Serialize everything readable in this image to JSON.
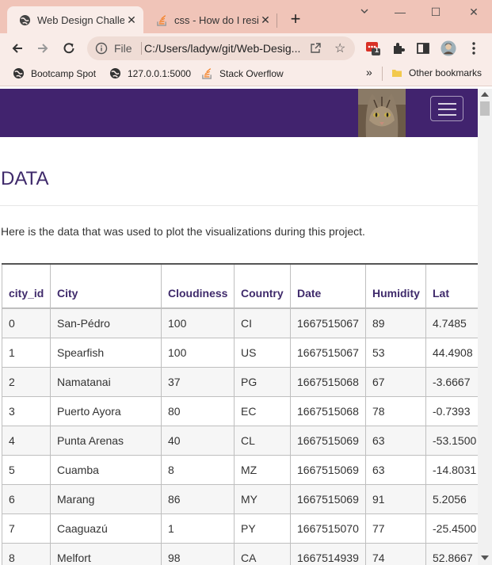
{
  "browser": {
    "tabs": [
      {
        "title": "Web Design Challen",
        "close": "✕"
      },
      {
        "title": "css - How do I resiz",
        "close": "✕"
      }
    ],
    "newtab": "+",
    "window_controls": {
      "minimize": "—",
      "maximize": "☐",
      "close": "✕"
    },
    "omnibox": {
      "scheme_label": "File",
      "url": "C:/Users/ladyw/git/Web-Desig..."
    },
    "extension_badge": "1",
    "bookmarks": [
      {
        "label": "Bootcamp Spot"
      },
      {
        "label": "127.0.0.1:5000"
      },
      {
        "label": "Stack Overflow"
      }
    ],
    "overflow": "»",
    "other_bookmarks": "Other bookmarks"
  },
  "page": {
    "heading": "DATA",
    "intro": "Here is the data that was used to plot the visualizations during this project.",
    "table": {
      "columns": [
        "city_id",
        "City",
        "Cloudiness",
        "Country",
        "Date",
        "Humidity",
        "Lat"
      ],
      "rows": [
        [
          "0",
          "San-Pédro",
          "100",
          "CI",
          "1667515067",
          "89",
          "4.7485"
        ],
        [
          "1",
          "Spearfish",
          "100",
          "US",
          "1667515067",
          "53",
          "44.4908"
        ],
        [
          "2",
          "Namatanai",
          "37",
          "PG",
          "1667515068",
          "67",
          "-3.6667"
        ],
        [
          "3",
          "Puerto Ayora",
          "80",
          "EC",
          "1667515068",
          "78",
          "-0.7393"
        ],
        [
          "4",
          "Punta Arenas",
          "40",
          "CL",
          "1667515069",
          "63",
          "-53.1500"
        ],
        [
          "5",
          "Cuamba",
          "8",
          "MZ",
          "1667515069",
          "63",
          "-14.8031"
        ],
        [
          "6",
          "Marang",
          "86",
          "MY",
          "1667515069",
          "91",
          "5.2056"
        ],
        [
          "7",
          "Caaguazú",
          "1",
          "PY",
          "1667515070",
          "77",
          "-25.4500"
        ],
        [
          "8",
          "Melfort",
          "98",
          "CA",
          "1667514939",
          "74",
          "52.8667"
        ]
      ]
    }
  },
  "colors": {
    "navbar": "#41236e",
    "heading": "#3f2a6b",
    "tabstrip": "#f0c4b8",
    "toolbar": "#f9ece8"
  }
}
